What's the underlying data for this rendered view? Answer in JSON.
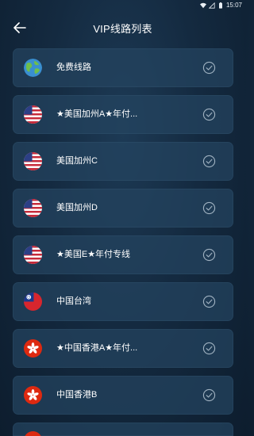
{
  "status_bar": {
    "time": "15:07"
  },
  "header": {
    "title": "VIP线路列表"
  },
  "routes": [
    {
      "label": "免费线路",
      "flag": "globe-icon"
    },
    {
      "label": "★美国加州A★年付...",
      "flag": "us-flag-icon"
    },
    {
      "label": "美国加州C",
      "flag": "us-flag-icon"
    },
    {
      "label": "美国加州D",
      "flag": "us-flag-icon"
    },
    {
      "label": "★美国E★年付专线",
      "flag": "us-flag-icon"
    },
    {
      "label": "中国台湾",
      "flag": "taiwan-flag-icon"
    },
    {
      "label": "★中国香港A★年付...",
      "flag": "hong-kong-flag-icon"
    },
    {
      "label": "中国香港B",
      "flag": "hong-kong-flag-icon"
    },
    {
      "label": "",
      "flag": "hong-kong-flag-icon"
    }
  ],
  "colors": {
    "card": "#244460",
    "background": "#142a40",
    "check": "#9fb1c0"
  }
}
